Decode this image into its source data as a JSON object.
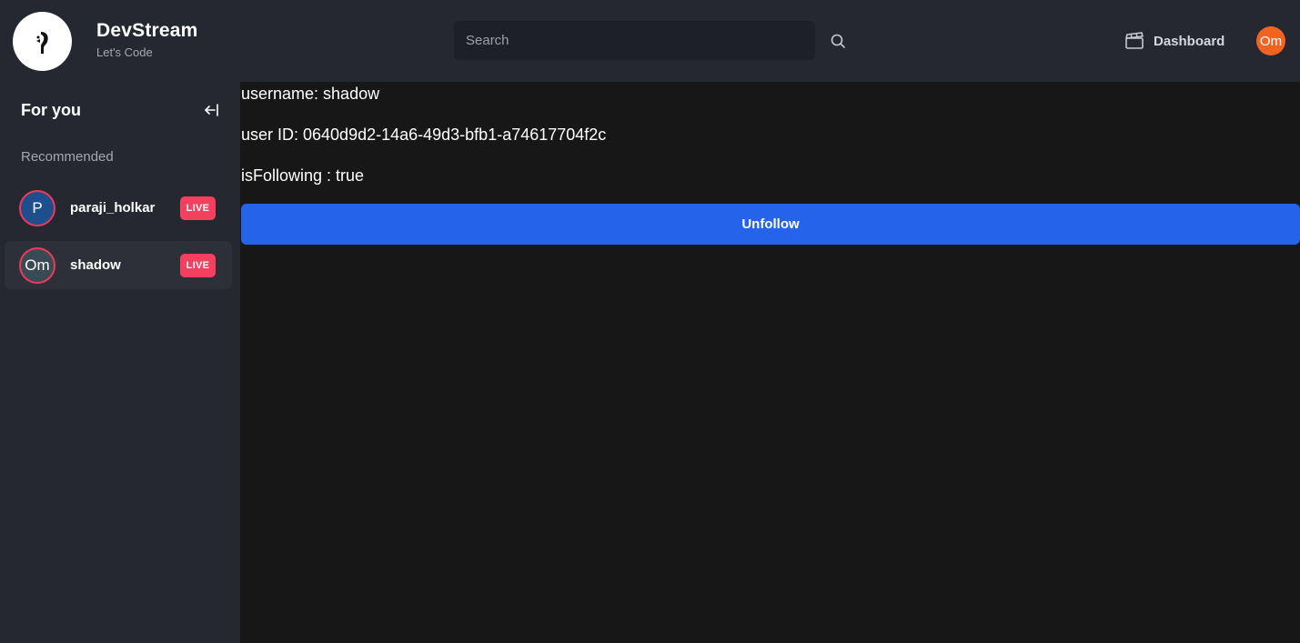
{
  "brand": {
    "title": "DevStream",
    "subtitle": "Let's Code"
  },
  "search": {
    "placeholder": "Search",
    "value": ""
  },
  "header": {
    "dashboard_label": "Dashboard",
    "avatar_initials": "Om",
    "avatar_color": "#f26322"
  },
  "sidebar": {
    "title": "For you",
    "section_label": "Recommended",
    "users": [
      {
        "initials": "P",
        "name": "paraji_holkar",
        "badge": "LIVE",
        "avatar_bg": "#1f4e8c"
      },
      {
        "initials": "Om",
        "name": "shadow",
        "badge": "LIVE",
        "avatar_bg": "#3a4a55"
      }
    ]
  },
  "main": {
    "username_line": "username: shadow",
    "userid_line": "user ID: 0640d9d2-14a6-49d3-bfb1-a74617704f2c",
    "following_line": "isFollowing : true",
    "unfollow_label": "Unfollow"
  },
  "colors": {
    "accent": "#2563eb",
    "live": "#f43f5e",
    "panel": "#252731",
    "background": "#171717"
  }
}
